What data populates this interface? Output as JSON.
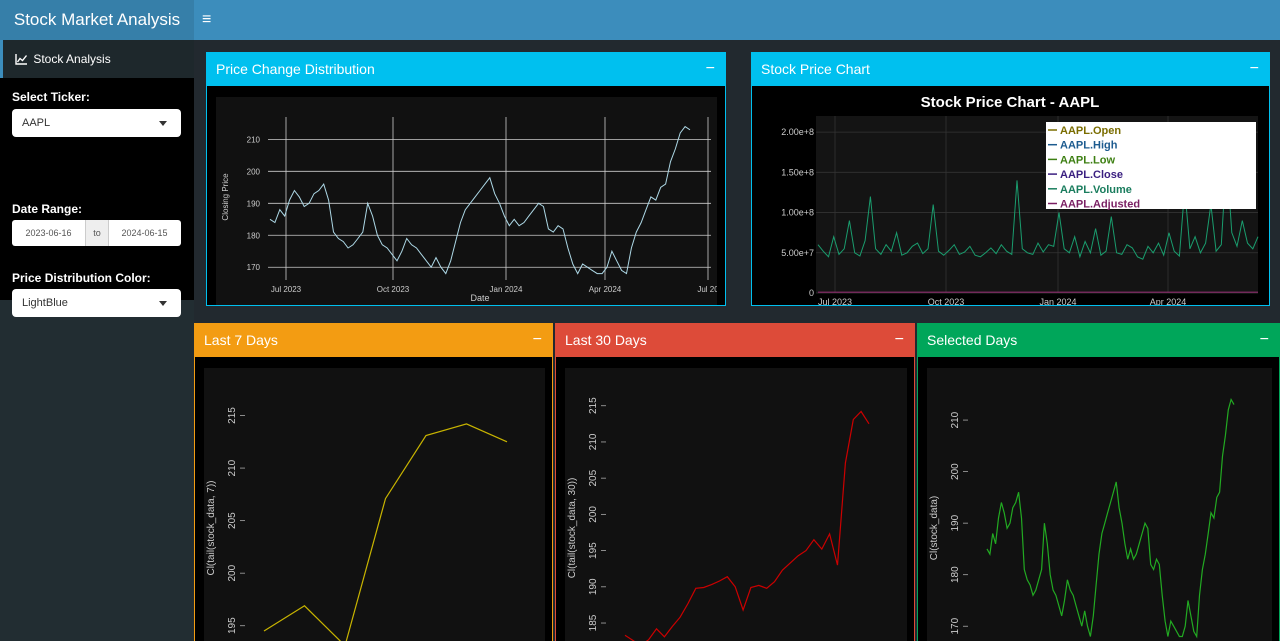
{
  "header": {
    "title": "Stock Market Analysis",
    "toggle_icon": "≡"
  },
  "sidebar": {
    "menu_item": "Stock Analysis",
    "ticker_label": "Select Ticker:",
    "ticker_value": "AAPL",
    "date_label": "Date Range:",
    "date_start": "2023-06-16",
    "date_sep": "to",
    "date_end": "2024-06-15",
    "color_label": "Price Distribution Color:",
    "color_value": "LightBlue"
  },
  "colors": {
    "header": "#3c8dbc",
    "info": "#00c0ef",
    "warning": "#f39c12",
    "danger": "#dd4b39",
    "success": "#00a65a"
  },
  "boxes": {
    "dist": {
      "title": "Price Change Distribution",
      "tool": "−"
    },
    "chart": {
      "title": "Stock Price Chart",
      "tool": "−"
    },
    "last7": {
      "title": "Last 7 Days",
      "tool": "−"
    },
    "last30": {
      "title": "Last 30 Days",
      "tool": "−"
    },
    "selected": {
      "title": "Selected Days",
      "tool": "−"
    }
  },
  "chart_data": [
    {
      "type": "line",
      "xlabel": "Date",
      "ylabel": "Closing Price",
      "xticks": [
        "Jul 2023",
        "Oct 2023",
        "Jan 2024",
        "Apr 2024",
        "Jul 20"
      ],
      "yticks": [
        "170",
        "180",
        "190",
        "200",
        "210"
      ],
      "ylim": [
        166,
        217
      ],
      "line_color": "#add8e6",
      "series": [
        {
          "values": [
            185,
            184,
            188,
            186,
            191,
            194,
            192,
            189,
            190,
            193,
            194,
            196,
            191,
            181,
            179,
            178,
            176,
            177,
            179,
            181,
            190,
            186,
            180,
            177,
            176,
            174,
            172,
            175,
            179,
            177,
            176,
            174,
            172,
            170,
            173,
            170,
            168,
            172,
            178,
            184,
            188,
            190,
            192,
            194,
            196,
            198,
            193,
            190,
            186,
            183,
            185,
            183,
            184,
            186,
            188,
            190,
            189,
            182,
            181,
            183,
            182,
            176,
            171,
            168,
            171,
            170,
            169,
            168,
            168,
            170,
            175,
            172,
            169,
            168,
            176,
            181,
            184,
            188,
            192,
            191,
            195,
            196,
            203,
            207,
            212,
            214,
            213
          ]
        }
      ]
    },
    {
      "type": "line",
      "title": "Stock Price Chart - AAPL",
      "xticks": [
        "Jul 2023",
        "Oct 2023",
        "Jan 2024",
        "Apr 2024"
      ],
      "yticks": [
        "0",
        "5.00e+7",
        "1.00e+8",
        "1.50e+8",
        "2.00e+8"
      ],
      "ylim": [
        0,
        220000000
      ],
      "legend": [
        "AAPL.Open",
        "AAPL.High",
        "AAPL.Low",
        "AAPL.Close",
        "AAPL.Volume",
        "AAPL.Adjusted"
      ],
      "legend_colors": [
        "#7a6d00",
        "#1d5b8f",
        "#3d7f12",
        "#3a1f80",
        "#1a7d5e",
        "#7a1f63"
      ],
      "legend_placement": "top-right",
      "series": [
        {
          "name": "AAPL.Volume",
          "values": [
            60000000,
            52000000,
            45000000,
            70000000,
            48000000,
            55000000,
            90000000,
            50000000,
            46000000,
            65000000,
            120000000,
            55000000,
            48000000,
            60000000,
            52000000,
            75000000,
            47000000,
            50000000,
            58000000,
            62000000,
            49000000,
            55000000,
            110000000,
            52000000,
            47000000,
            53000000,
            60000000,
            48000000,
            51000000,
            58000000,
            47000000,
            45000000,
            50000000,
            56000000,
            49000000,
            60000000,
            52000000,
            48000000,
            140000000,
            55000000,
            50000000,
            48000000,
            62000000,
            51000000,
            60000000,
            58000000,
            100000000,
            55000000,
            50000000,
            70000000,
            45000000,
            64000000,
            50000000,
            80000000,
            47000000,
            52000000,
            95000000,
            50000000,
            48000000,
            60000000,
            56000000,
            45000000,
            42000000,
            58000000,
            50000000,
            62000000,
            47000000,
            75000000,
            52000000,
            46000000,
            130000000,
            55000000,
            70000000,
            50000000,
            62000000,
            110000000,
            52000000,
            60000000,
            170000000,
            75000000,
            58000000,
            90000000,
            62000000,
            55000000,
            70000000
          ]
        },
        {
          "name": "AAPL.Adjusted",
          "values": [
            185,
            190,
            180,
            175,
            195,
            185,
            190,
            180,
            178,
            175,
            172,
            176
          ]
        }
      ]
    },
    {
      "type": "line",
      "ylabel": "Cl(tail(stock_data, 7))",
      "yticks": [
        "195",
        "200",
        "205",
        "210",
        "215"
      ],
      "ylim": [
        192.5,
        218
      ],
      "line_color": "#c8b400",
      "series": [
        {
          "values": [
            194.5,
            196.9,
            193.1,
            207.1,
            213.1,
            214.2,
            212.5
          ]
        }
      ]
    },
    {
      "type": "line",
      "ylabel": "Cl(tail(stock_data, 30))",
      "yticks": [
        "185",
        "190",
        "195",
        "200",
        "205",
        "210",
        "215"
      ],
      "ylim": [
        181,
        218
      ],
      "line_color": "#cc0000",
      "series": [
        {
          "values": [
            183.3,
            182.6,
            181.9,
            182.7,
            184.2,
            183.1,
            184.5,
            185.8,
            187.7,
            189.8,
            189.9,
            190.3,
            190.8,
            191.4,
            190.0,
            186.8,
            189.9,
            190.2,
            189.8,
            190.7,
            192.3,
            193.3,
            194.3,
            195.0,
            196.5,
            195.2,
            197.3,
            193.0,
            207.1,
            213.1,
            214.2,
            212.5
          ]
        }
      ]
    },
    {
      "type": "line",
      "ylabel": "Cl(stock_data)",
      "yticks": [
        "170",
        "180",
        "190",
        "200",
        "210"
      ],
      "ylim": [
        165,
        217
      ],
      "line_color": "#22aa22",
      "series": [
        {
          "values": [
            185,
            184,
            188,
            186,
            191,
            194,
            192,
            189,
            190,
            193,
            194,
            196,
            191,
            181,
            179,
            178,
            176,
            177,
            179,
            181,
            190,
            186,
            180,
            177,
            176,
            174,
            172,
            175,
            179,
            177,
            176,
            174,
            172,
            170,
            173,
            170,
            168,
            172,
            178,
            184,
            188,
            190,
            192,
            194,
            196,
            198,
            193,
            190,
            186,
            183,
            185,
            183,
            184,
            186,
            188,
            190,
            189,
            182,
            181,
            183,
            182,
            176,
            171,
            168,
            171,
            170,
            169,
            168,
            168,
            170,
            175,
            172,
            169,
            168,
            176,
            181,
            184,
            188,
            192,
            191,
            195,
            196,
            203,
            207,
            212,
            214,
            213
          ]
        }
      ]
    }
  ]
}
